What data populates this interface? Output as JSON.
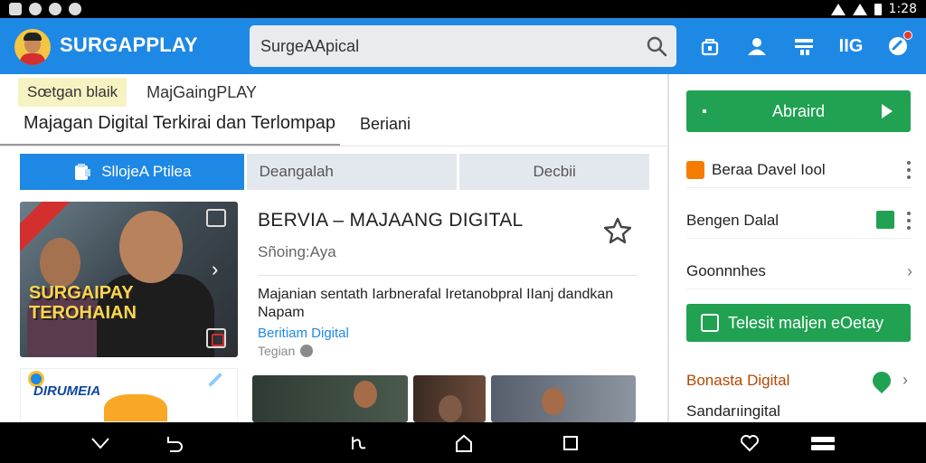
{
  "status_bar": {
    "time": "1:28"
  },
  "app_bar": {
    "brand": "SURGAPPLAY",
    "search_value": "SurgeAApical",
    "icon_text": "IIG"
  },
  "main": {
    "tag_highlight": "Sœtgan blaik",
    "tag_plain": "MajGaingPLAY",
    "page_title": "Majagan Digital Terkirai dan Terlompap",
    "side_link": "Beriani",
    "tabs": [
      {
        "label": "SllojeA Ptilea"
      },
      {
        "label": "Deangalah"
      },
      {
        "label": "Decbii"
      }
    ],
    "card": {
      "thumb_title_line1": "SURGAIPAY",
      "thumb_title_line2": "TEROHAIAN",
      "title": "BERVIA – MAJAANG DIGITAL",
      "subtitle": "Sñoing:Aya",
      "description": "Majanian sentath Iarbnerafal Iretanobpral IIanj dandkan Napam",
      "link": "Beritiam Digital",
      "meta": "Tegian"
    },
    "mini_card_title": "DIRUMEIA"
  },
  "sidebar": {
    "top_button": "Abraird",
    "items": [
      {
        "label": "Beraa Davel Iool"
      },
      {
        "label": "Bengen Dalal"
      },
      {
        "label": "Goonnnhes"
      }
    ],
    "mid_button": "Telesit maljen eOetay",
    "orange_item": "Bonasta Digital",
    "last_item": "Sandarıingital"
  },
  "colors": {
    "primary": "#1e88e5",
    "green": "#21a152",
    "tag_bg": "#f6f3c2"
  }
}
